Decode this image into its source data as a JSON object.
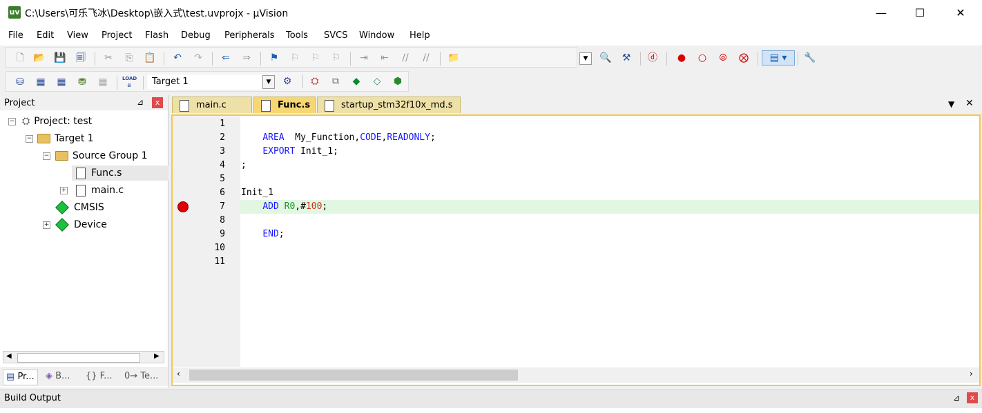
{
  "window": {
    "title": "C:\\Users\\可乐飞冰\\Desktop\\嵌入式\\test.uvprojx - µVision",
    "app_icon": "uv",
    "minimize": "—",
    "maximize": "☐",
    "close": "✕"
  },
  "menu": [
    "File",
    "Edit",
    "View",
    "Project",
    "Flash",
    "Debug",
    "Peripherals",
    "Tools",
    "SVCS",
    "Window",
    "Help"
  ],
  "toolbar2": {
    "target": "Target 1",
    "load": "LOAD"
  },
  "project_pane": {
    "title": "Project",
    "pin": "⊿",
    "close": "x",
    "tree": [
      {
        "label": "Project: test",
        "icon": "project-icon"
      },
      {
        "label": "Target 1",
        "icon": "target-folder-icon"
      },
      {
        "label": "Source Group 1",
        "icon": "folder-icon"
      },
      {
        "label": "Func.s",
        "icon": "file-icon"
      },
      {
        "label": "main.c",
        "icon": "file-icon"
      },
      {
        "label": "CMSIS",
        "icon": "diamond-icon"
      },
      {
        "label": "Device",
        "icon": "diamond-icon"
      }
    ],
    "tabs": [
      "Pr...",
      "B...",
      "{} F...",
      "0→ Te..."
    ]
  },
  "editor": {
    "tabs": [
      {
        "label": "main.c",
        "active": false
      },
      {
        "label": "Func.s",
        "active": true
      },
      {
        "label": "startup_stm32f10x_md.s",
        "active": false
      }
    ],
    "line_numbers": [
      "1",
      "2",
      "3",
      "4",
      "5",
      "6",
      "7",
      "8",
      "9",
      "10",
      "11"
    ],
    "lines": {
      "l2_kw": "AREA",
      "l2_name": "  My_Function,",
      "l2_code": "CODE",
      "l2_comma": ",",
      "l2_ro": "READONLY",
      "l2_end": ";",
      "l3_kw": "EXPORT",
      "l3_rest": " Init_1;",
      "l4": ";",
      "l6": "Init_1",
      "l7_kw": "ADD",
      "l7_sp": " ",
      "l7_reg": "R0",
      "l7_comma": ",#",
      "l7_num": "100",
      "l7_end": ";",
      "l9_kw": "END",
      "l9_end": ";"
    },
    "breakpoint_line": 7,
    "highlight_line": 7
  },
  "build_output": {
    "title": "Build Output",
    "pin": "⊿",
    "close": "x"
  },
  "colors": {
    "keyword": "#1717ff",
    "register": "#189428",
    "number": "#c8341a",
    "active_tab": "#f7d774",
    "breakpoint": "#e00000"
  }
}
